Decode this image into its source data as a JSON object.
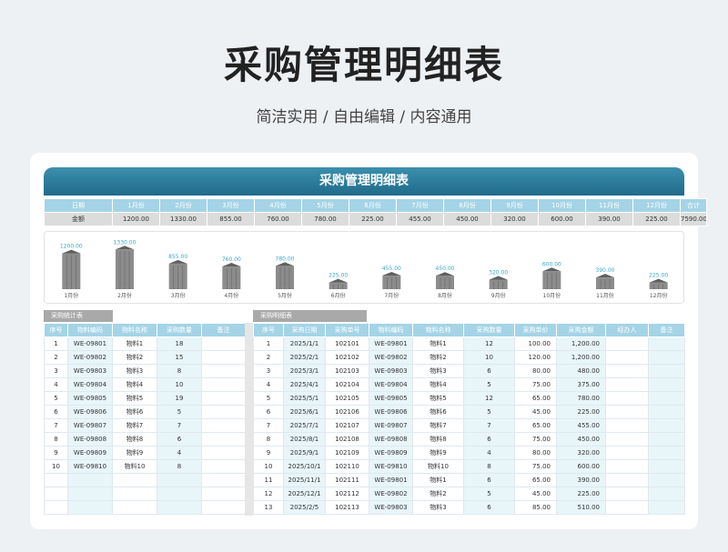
{
  "page": {
    "title": "采购管理明细表",
    "subtitle": "简洁实用 / 自由编辑 / 内容通用"
  },
  "sheet": {
    "header": "采购管理明细表",
    "month_table": {
      "date_label": "日期",
      "amount_label": "金额",
      "months": [
        "1月份",
        "2月份",
        "3月份",
        "4月份",
        "5月份",
        "6月份",
        "7月份",
        "8月份",
        "9月份",
        "10月份",
        "11月份",
        "12月份"
      ],
      "total_label": "合计",
      "amounts": [
        "1200.00",
        "1330.00",
        "855.00",
        "760.00",
        "780.00",
        "225.00",
        "455.00",
        "450.00",
        "320.00",
        "600.00",
        "390.00",
        "225.00"
      ],
      "total": "7590.00"
    },
    "left_tab": "采购统计表",
    "right_tab": "采购明细表",
    "left_table": {
      "headers": [
        "序号",
        "物料编码",
        "物料名称",
        "采购数量",
        "备注"
      ],
      "rows": [
        [
          "1",
          "WE-09801",
          "物料1",
          "18",
          ""
        ],
        [
          "2",
          "WE-09802",
          "物料2",
          "15",
          ""
        ],
        [
          "3",
          "WE-09803",
          "物料3",
          "8",
          ""
        ],
        [
          "4",
          "WE-09804",
          "物料4",
          "10",
          ""
        ],
        [
          "5",
          "WE-09805",
          "物料5",
          "19",
          ""
        ],
        [
          "6",
          "WE-09806",
          "物料6",
          "5",
          ""
        ],
        [
          "7",
          "WE-09807",
          "物料7",
          "7",
          ""
        ],
        [
          "8",
          "WE-09808",
          "物料8",
          "6",
          ""
        ],
        [
          "9",
          "WE-09809",
          "物料9",
          "4",
          ""
        ],
        [
          "10",
          "WE-09810",
          "物料10",
          "8",
          ""
        ],
        [
          "",
          "",
          "",
          "",
          ""
        ],
        [
          "",
          "",
          "",
          "",
          ""
        ],
        [
          "",
          "",
          "",
          "",
          ""
        ]
      ]
    },
    "right_table": {
      "headers": [
        "序号",
        "采购日期",
        "采购单号",
        "物料编码",
        "物料名称",
        "采购数量",
        "采购单价",
        "采购金额",
        "经办人",
        "备注"
      ],
      "rows": [
        [
          "1",
          "2025/1/1",
          "102101",
          "WE-09801",
          "物料1",
          "12",
          "100.00",
          "1,200.00",
          "",
          ""
        ],
        [
          "2",
          "2025/2/1",
          "102102",
          "WE-09802",
          "物料2",
          "10",
          "120.00",
          "1,200.00",
          "",
          ""
        ],
        [
          "3",
          "2025/3/1",
          "102103",
          "WE-09803",
          "物料3",
          "6",
          "80.00",
          "480.00",
          "",
          ""
        ],
        [
          "4",
          "2025/4/1",
          "102104",
          "WE-09804",
          "物料4",
          "5",
          "75.00",
          "375.00",
          "",
          ""
        ],
        [
          "5",
          "2025/5/1",
          "102105",
          "WE-09805",
          "物料5",
          "12",
          "65.00",
          "780.00",
          "",
          ""
        ],
        [
          "6",
          "2025/6/1",
          "102106",
          "WE-09806",
          "物料6",
          "5",
          "45.00",
          "225.00",
          "",
          ""
        ],
        [
          "7",
          "2025/7/1",
          "102107",
          "WE-09807",
          "物料7",
          "7",
          "65.00",
          "455.00",
          "",
          ""
        ],
        [
          "8",
          "2025/8/1",
          "102108",
          "WE-09808",
          "物料8",
          "6",
          "75.00",
          "450.00",
          "",
          ""
        ],
        [
          "9",
          "2025/9/1",
          "102109",
          "WE-09809",
          "物料9",
          "4",
          "80.00",
          "320.00",
          "",
          ""
        ],
        [
          "10",
          "2025/10/1",
          "102110",
          "WE-09810",
          "物料10",
          "8",
          "75.00",
          "600.00",
          "",
          ""
        ],
        [
          "11",
          "2025/11/1",
          "102111",
          "WE-09801",
          "物料1",
          "6",
          "65.00",
          "390.00",
          "",
          ""
        ],
        [
          "12",
          "2025/12/1",
          "102112",
          "WE-09802",
          "物料2",
          "5",
          "45.00",
          "225.00",
          "",
          ""
        ],
        [
          "13",
          "2025/2/5",
          "102113",
          "WE-09803",
          "物料3",
          "6",
          "85.00",
          "510.00",
          "",
          ""
        ]
      ]
    }
  },
  "chart_data": {
    "type": "bar",
    "categories": [
      "1月份",
      "2月份",
      "3月份",
      "4月份",
      "5月份",
      "6月份",
      "7月份",
      "8月份",
      "9月份",
      "10月份",
      "11月份",
      "12月份"
    ],
    "values": [
      1200,
      1330,
      855,
      760,
      780,
      225,
      455,
      450,
      320,
      600,
      390,
      225
    ],
    "value_labels": [
      "1200.00",
      "1330.00",
      "855.00",
      "760.00",
      "780.00",
      "225.00",
      "455.00",
      "450.00",
      "320.00",
      "600.00",
      "390.00",
      "225.00"
    ],
    "ylim": [
      0,
      1400
    ],
    "colors": {
      "bar": "#8c8c8c",
      "label": "#3aa6c9"
    }
  }
}
